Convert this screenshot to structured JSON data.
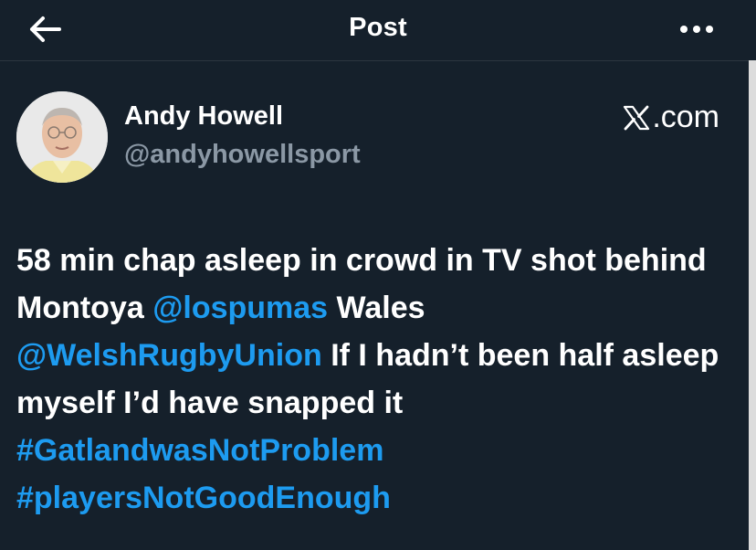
{
  "header": {
    "title": "Post"
  },
  "author": {
    "name": "Andy Howell",
    "handle": "@andyhowellsport"
  },
  "brand": {
    "text": ".com"
  },
  "post": {
    "segments": [
      {
        "t": "58 min chap asleep in crowd in TV shot behind Montoya ",
        "link": false
      },
      {
        "t": "@lospumas",
        "link": true
      },
      {
        "t": " Wales ",
        "link": false
      },
      {
        "t": "@WelshRugbyUnion",
        "link": true
      },
      {
        "t": " If I hadn’t been half asleep myself I’d have snapped it ",
        "link": false
      },
      {
        "t": "#GatlandwasNotProblem",
        "link": true
      },
      {
        "t": " ",
        "link": false
      },
      {
        "t": "#playersNotGoodEnough",
        "link": true
      }
    ]
  },
  "colors": {
    "background": "#15202b",
    "link": "#1d9bf0",
    "secondary_text": "#8b98a5"
  },
  "icons": [
    "arrow-left-icon",
    "more-options-icon",
    "x-logo-icon",
    "avatar"
  ]
}
